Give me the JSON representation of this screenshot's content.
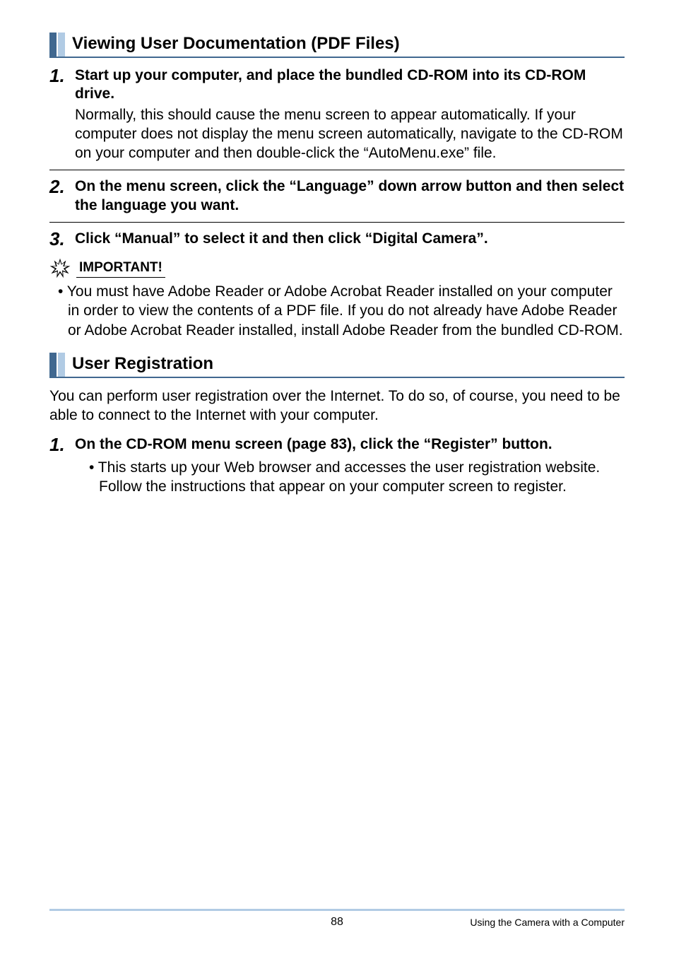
{
  "section1": {
    "title": "Viewing User Documentation (PDF Files)",
    "step1": {
      "num": "1.",
      "head": "Start up your computer, and place the bundled CD-ROM into its CD-ROM drive.",
      "desc": "Normally, this should cause the menu screen to appear automatically. If your computer does not display the menu screen automatically, navigate to the CD-ROM on your computer and then double-click the “AutoMenu.exe” file."
    },
    "step2": {
      "num": "2.",
      "head": "On the menu screen, click the “Language” down arrow button and then select the language you want."
    },
    "step3": {
      "num": "3.",
      "head": "Click “Manual” to select it and then click “Digital Camera”."
    },
    "important": {
      "label": "IMPORTANT!",
      "text": "• You must have Adobe Reader or Adobe Acrobat Reader installed on your computer in order to view the contents of a PDF file. If you do not already have Adobe Reader or Adobe Acrobat Reader installed, install Adobe Reader from the bundled CD-ROM."
    }
  },
  "section2": {
    "title": "User Registration",
    "intro": "You can perform user registration over the Internet. To do so, of course, you need to be able to connect to the Internet with your computer.",
    "step1": {
      "num": "1.",
      "head": "On the CD-ROM menu screen (page 83), click the “Register” button.",
      "bullet": "• This starts up your Web browser and accesses the user registration website. Follow the instructions that appear on your computer screen to register."
    }
  },
  "footer": {
    "page": "88",
    "title": "Using the Camera with a Computer"
  }
}
